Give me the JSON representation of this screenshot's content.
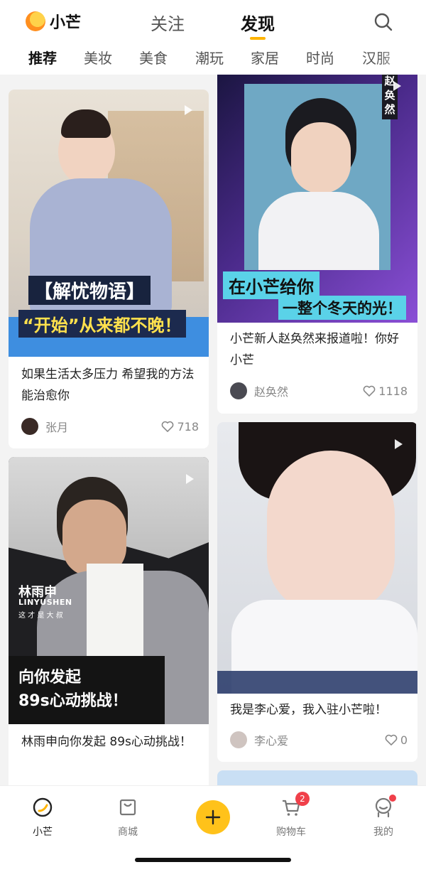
{
  "header": {
    "logo_text": "小芒",
    "tabs": [
      {
        "label": "关注",
        "active": false
      },
      {
        "label": "发现",
        "active": true
      }
    ],
    "search_icon": "search-icon",
    "accent_color": "#ffb400"
  },
  "categories": [
    "推荐",
    "美妆",
    "美食",
    "潮玩",
    "家居",
    "时尚",
    "汉服"
  ],
  "feed": [
    {
      "title": "如果生活太多压力 希望我的方法能治愈你",
      "author": "张月",
      "likes": "718",
      "overlay_1": "【解忧物语】",
      "overlay_2": "“开始”从来都不晚！"
    },
    {
      "title": "小芒新人赵奂然来报道啦！你好小芒",
      "author": "赵奂然",
      "likes": "1118",
      "overlay_name": "赵奂然",
      "overlay_1": "在小芒给你",
      "overlay_2": "一整个冬天的光！"
    },
    {
      "title": "林雨申向你发起 89s心动挑战！",
      "overlay_name_cn": "林雨申",
      "overlay_name_en": "LINYUSHEN",
      "overlay_tag": "这 才 是 大 叔",
      "overlay_1": "向你发起",
      "overlay_2": "89s心动挑战！"
    },
    {
      "title": "我是李心爱，我入驻小芒啦！",
      "author": "李心爱",
      "likes": "0"
    }
  ],
  "bottom_nav": [
    {
      "label": "小芒",
      "icon": "home-icon",
      "active": true
    },
    {
      "label": "商城",
      "icon": "bag-icon"
    },
    {
      "label": "",
      "icon": "plus-icon"
    },
    {
      "label": "购物车",
      "icon": "cart-icon",
      "badge": "2"
    },
    {
      "label": "我的",
      "icon": "profile-icon",
      "dot": true
    }
  ],
  "colors": {
    "badge": "#f0404a",
    "plus_button": "#ffc21a"
  }
}
